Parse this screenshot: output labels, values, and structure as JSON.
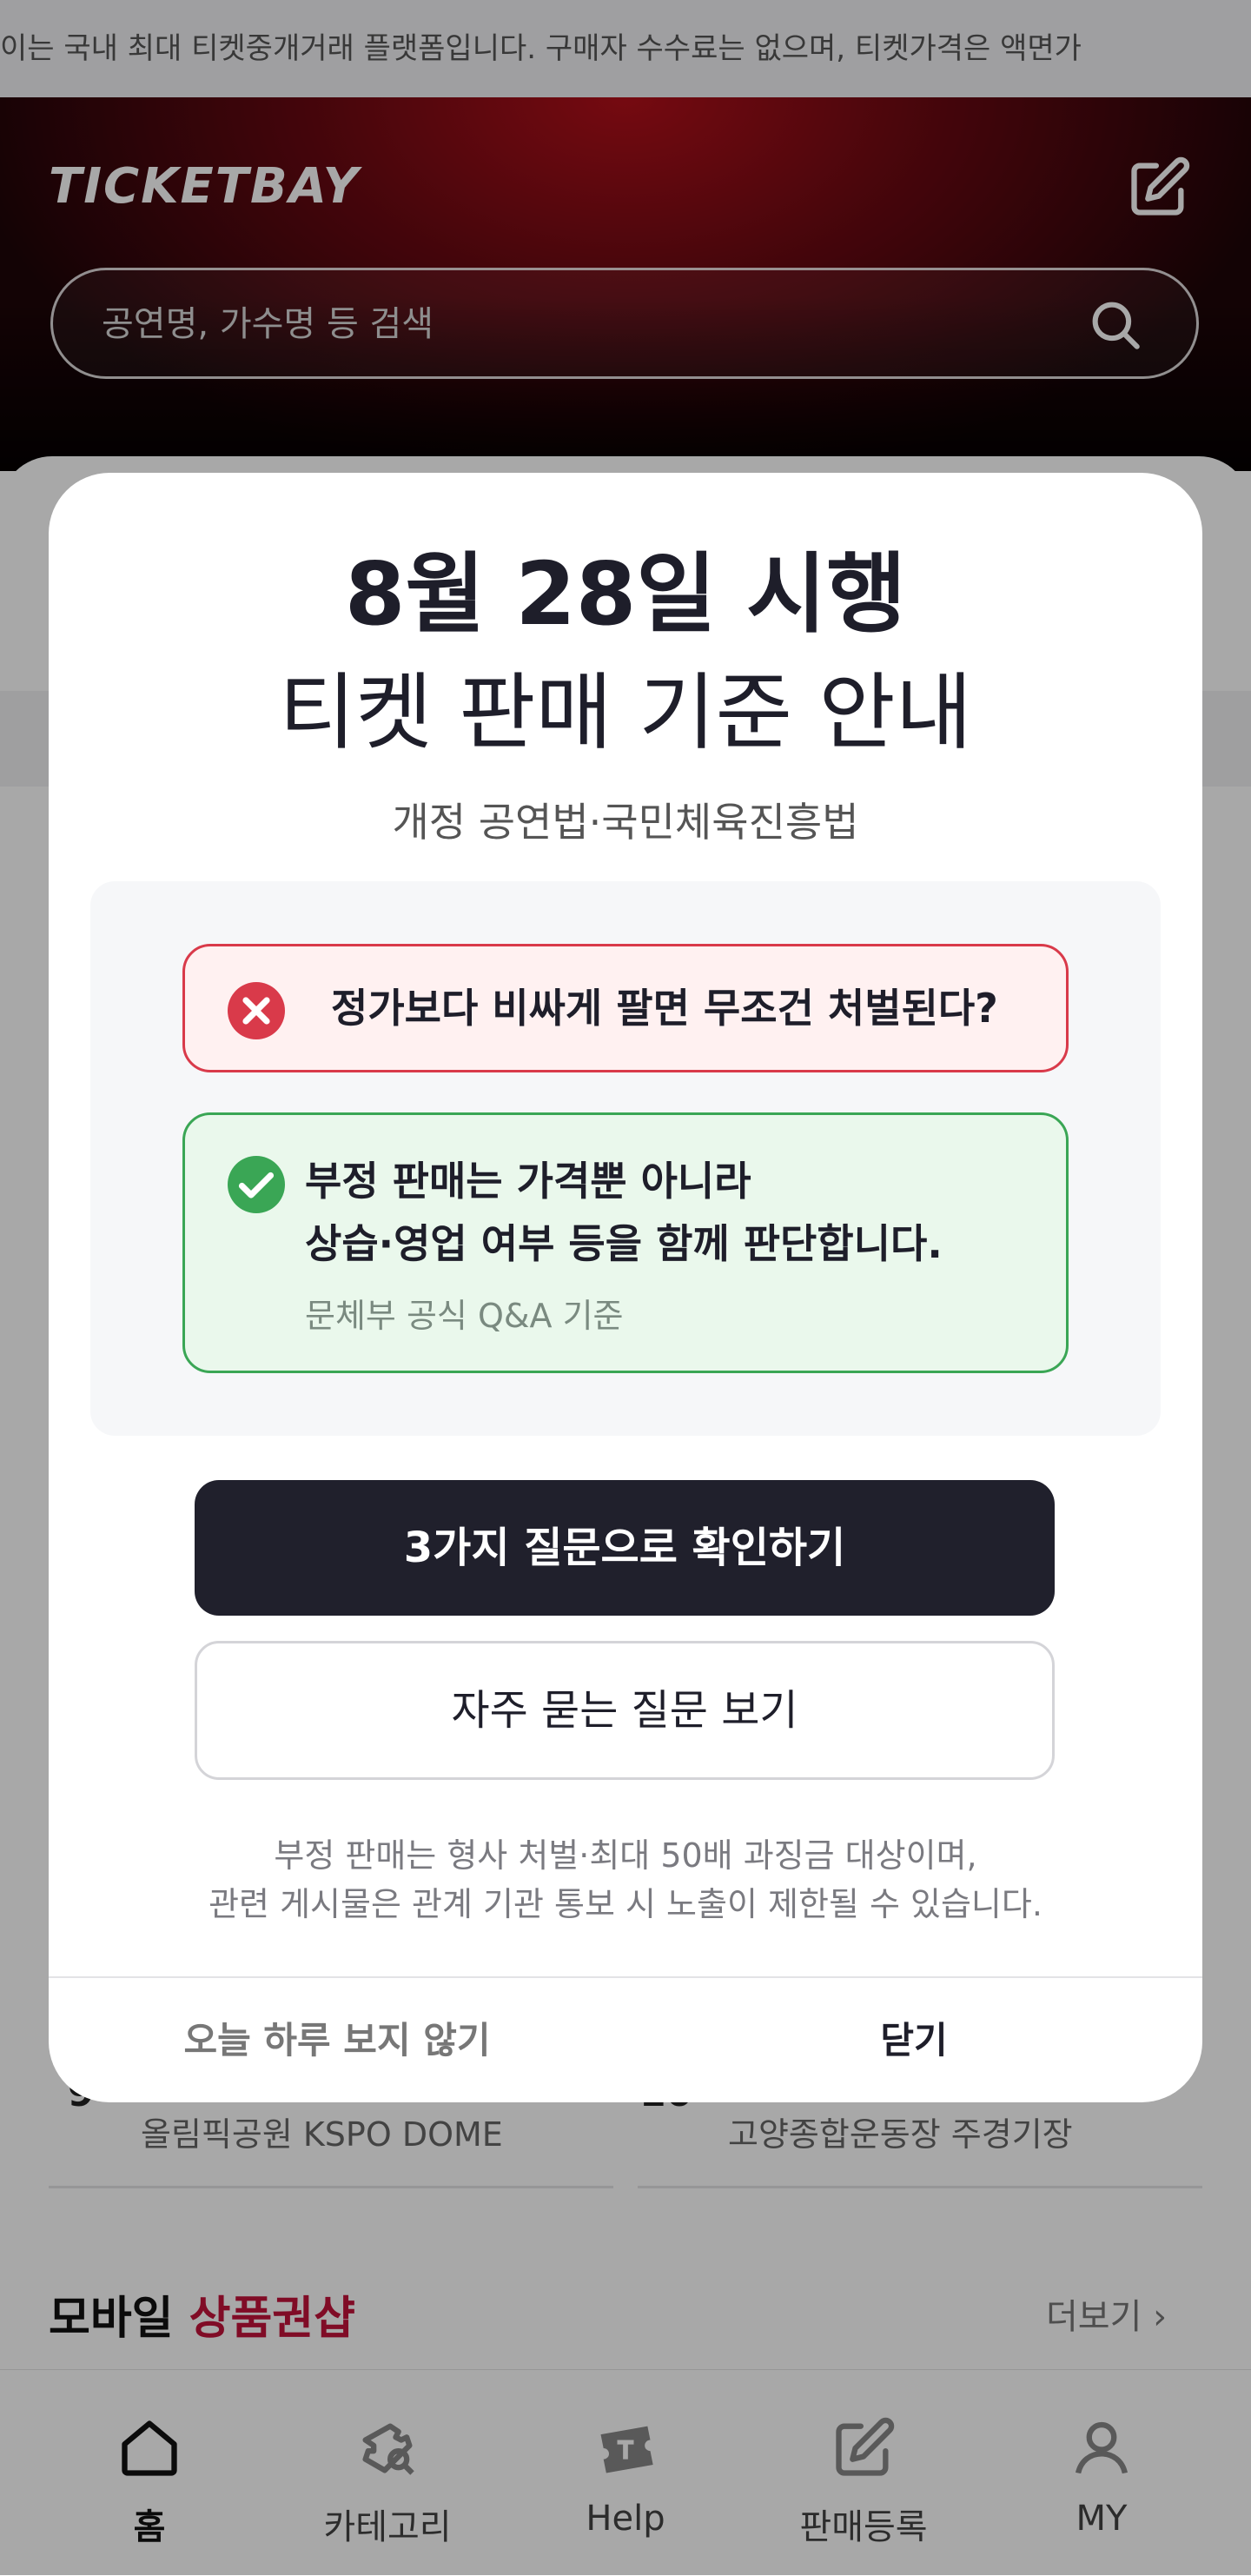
{
  "ticker": {
    "text": "이는 국내 최대 티켓중개거래 플랫폼입니다. 구매자 수수료는 없으며, 티켓가격은 액면가"
  },
  "header": {
    "logo": "TICKETBAY",
    "search_placeholder": "공연명, 가수명 등 검색",
    "icons": {
      "edit": "edit-icon",
      "search": "search-icon"
    }
  },
  "background_page": {
    "venues": [
      {
        "num": "9",
        "name": "올림픽공원 KSPO DOME"
      },
      {
        "num": "10",
        "name": "고양종합운동장 주경기장"
      }
    ],
    "section_title_plain": "모바일 ",
    "section_title_accent": "상품권샵",
    "more_label": "더보기 ›",
    "accent_color": "#c2133a"
  },
  "modal": {
    "title_line1": "8월 28일 시행",
    "title_line2": "티켓 판매 기준 안내",
    "subtitle": "개정 공연법·국민체육진흥법",
    "wrong_claim": "정가보다 비싸게 팔면 무조건 처벌된다?",
    "correct_line1": "부정 판매는 가격뿐 아니라",
    "correct_line2": "상습·영업 여부 등을 함께 판단합니다.",
    "correct_source": "문체부 공식 Q&A 기준",
    "primary_button": "3가지 질문으로 확인하기",
    "secondary_button": "자주 묻는 질문 보기",
    "notice_line1": "부정 판매는 형사 처벌·최대 50배 과징금 대상이며,",
    "notice_line2": "관련 게시물은 관계 기관 통보 시 노출이 제한될 수 있습니다.",
    "dismiss_today": "오늘 하루 보지 않기",
    "close": "닫기",
    "colors": {
      "wrong": "#d93a4a",
      "correct": "#3aa655",
      "primary_bg": "#20202c"
    }
  },
  "tabbar": {
    "items": [
      {
        "label": "홈",
        "icon": "home-icon",
        "active": true
      },
      {
        "label": "카테고리",
        "icon": "category-icon",
        "active": false
      },
      {
        "label": "Help",
        "icon": "ticket-help-icon",
        "active": false
      },
      {
        "label": "판매등록",
        "icon": "sell-register-icon",
        "active": false
      },
      {
        "label": "MY",
        "icon": "user-icon",
        "active": false
      }
    ]
  }
}
